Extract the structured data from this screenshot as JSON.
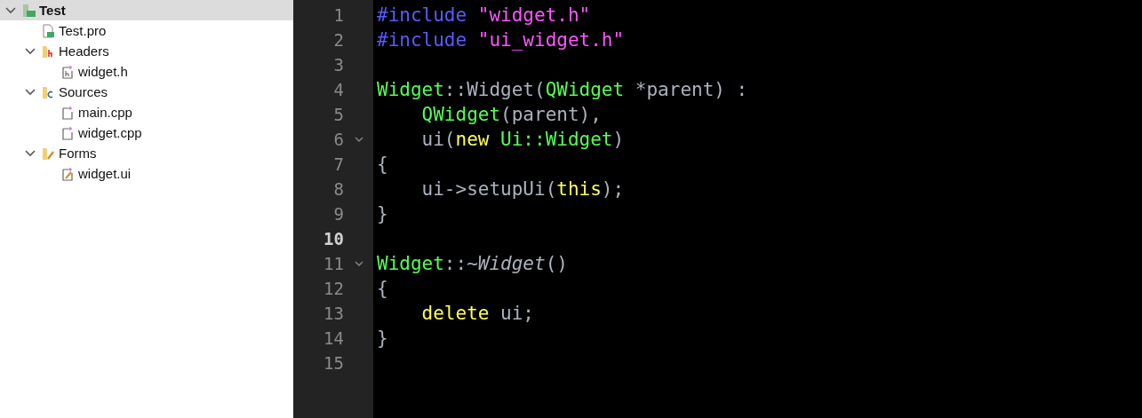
{
  "project_tree": [
    {
      "label": "Test",
      "kind": "project",
      "selected": true,
      "expanded": true,
      "children": [
        {
          "label": "Test.pro",
          "kind": "pro-file",
          "selected": false
        },
        {
          "label": "Headers",
          "kind": "headers-folder",
          "selected": false,
          "expanded": true,
          "children": [
            {
              "label": "widget.h",
              "kind": "header-file",
              "selected": false
            }
          ]
        },
        {
          "label": "Sources",
          "kind": "sources-folder",
          "selected": false,
          "expanded": true,
          "children": [
            {
              "label": "main.cpp",
              "kind": "source-file",
              "selected": false
            },
            {
              "label": "widget.cpp",
              "kind": "source-file",
              "selected": false
            }
          ]
        },
        {
          "label": "Forms",
          "kind": "forms-folder",
          "selected": false,
          "expanded": true,
          "children": [
            {
              "label": "widget.ui",
              "kind": "form-file",
              "selected": false
            }
          ]
        }
      ]
    }
  ],
  "editor": {
    "lines": [
      {
        "number": "1",
        "current": false,
        "tokens": [
          {
            "t": "#include ",
            "kind": "preproc"
          },
          {
            "t": "\"widget.h\"",
            "kind": "string"
          }
        ]
      },
      {
        "number": "2",
        "current": false,
        "tokens": [
          {
            "t": "#include ",
            "kind": "preproc"
          },
          {
            "t": "\"ui_widget.h\"",
            "kind": "string"
          }
        ]
      },
      {
        "number": "3",
        "current": false
      },
      {
        "number": "4",
        "current": false,
        "tokens": [
          {
            "t": "Widget",
            "kind": "type"
          },
          {
            "t": "::Widget(",
            "kind": "plain"
          },
          {
            "t": "QWidget",
            "kind": "type"
          },
          {
            "t": " *parent) :",
            "kind": "plain"
          }
        ]
      },
      {
        "number": "5",
        "current": false,
        "indent": true,
        "tokens": [
          {
            "t": "QWidget",
            "kind": "type"
          },
          {
            "t": "(parent),",
            "kind": "plain"
          }
        ]
      },
      {
        "number": "6",
        "current": false,
        "foldable": true,
        "indent": true,
        "tokens": [
          {
            "t": "ui(",
            "kind": "plain"
          },
          {
            "t": "new ",
            "kind": "keyword"
          },
          {
            "t": "Ui::Widget",
            "kind": "type"
          },
          {
            "t": ")",
            "kind": "plain"
          }
        ]
      },
      {
        "number": "7",
        "current": false,
        "tokens": [
          {
            "t": "{",
            "kind": "plain"
          }
        ]
      },
      {
        "number": "8",
        "current": false,
        "indent": true,
        "tokens": [
          {
            "t": "ui->setupUi(",
            "kind": "plain"
          },
          {
            "t": "this",
            "kind": "keyword"
          },
          {
            "t": ");",
            "kind": "plain"
          }
        ]
      },
      {
        "number": "9",
        "current": false,
        "tokens": [
          {
            "t": "}",
            "kind": "plain"
          }
        ]
      },
      {
        "number": "10",
        "current": true
      },
      {
        "number": "11",
        "current": false,
        "foldable": true,
        "tokens": [
          {
            "t": "Widget",
            "kind": "type"
          },
          {
            "t": "::",
            "kind": "plain"
          },
          {
            "t": "~Widget",
            "kind": "italic"
          },
          {
            "t": "()",
            "kind": "plain"
          }
        ]
      },
      {
        "number": "12",
        "current": false,
        "tokens": [
          {
            "t": "{",
            "kind": "plain"
          }
        ]
      },
      {
        "number": "13",
        "current": false,
        "indent": true,
        "tokens": [
          {
            "t": "delete",
            "kind": "keyword"
          },
          {
            "t": " ui;",
            "kind": "plain"
          }
        ]
      },
      {
        "number": "14",
        "current": false,
        "tokens": [
          {
            "t": "}",
            "kind": "plain"
          }
        ]
      },
      {
        "number": "15",
        "current": false
      }
    ]
  }
}
